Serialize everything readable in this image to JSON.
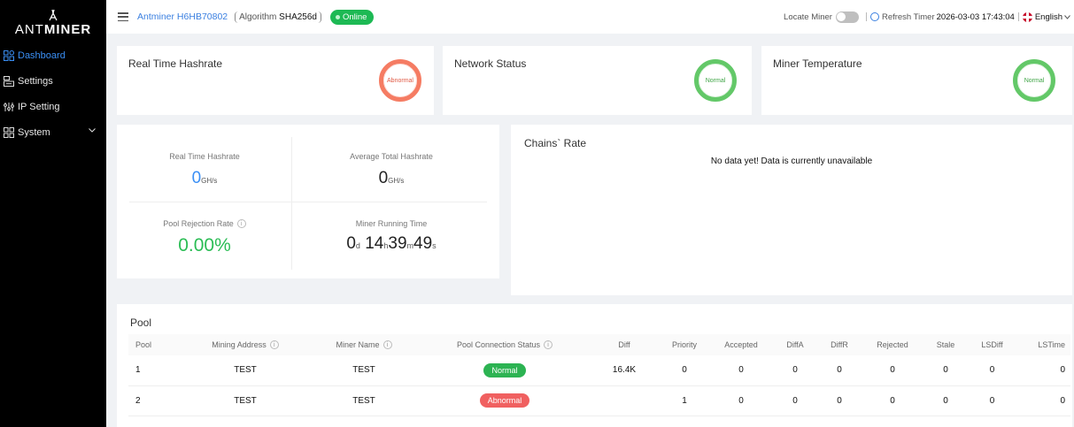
{
  "sidebar": {
    "logo_text_light": "ANT",
    "logo_text_bold": "MINER",
    "items": [
      {
        "label": "Dashboard"
      },
      {
        "label": "Settings"
      },
      {
        "label": "IP Setting"
      },
      {
        "label": "System"
      }
    ]
  },
  "header": {
    "miner_name": "Antminer H6HB70802",
    "algorithm_label": "Algorithm",
    "algorithm_value": "SHA256d",
    "status": "Online",
    "locate_label": "Locate Miner",
    "refresh_label": "Refresh Timer",
    "timestamp": "2026-03-03 17:43:04",
    "language": "English"
  },
  "status_cards": [
    {
      "title": "Real Time Hashrate",
      "state": "Abnormal"
    },
    {
      "title": "Network Status",
      "state": "Normal"
    },
    {
      "title": "Miner Temperature",
      "state": "Normal"
    }
  ],
  "metrics": {
    "rt_hashrate_label": "Real Time Hashrate",
    "rt_hashrate_value": "0",
    "rt_hashrate_unit": "GH/s",
    "avg_hashrate_label": "Average Total Hashrate",
    "avg_hashrate_value": "0",
    "avg_hashrate_unit": "GH/s",
    "rejection_label": "Pool Rejection Rate",
    "rejection_value": "0.00%",
    "runtime_label": "Miner Running Time",
    "runtime": {
      "d": "0",
      "d_u": "d",
      "h": "14",
      "h_u": "h",
      "m": "39",
      "m_u": "m",
      "s": "49",
      "s_u": "s"
    }
  },
  "chains": {
    "title": "Chains` Rate",
    "empty": "No data yet! Data is currently unavailable"
  },
  "pool": {
    "title": "Pool",
    "columns": [
      "Pool",
      "Mining Address",
      "Miner Name",
      "Pool Connection Status",
      "Diff",
      "Priority",
      "Accepted",
      "DiffA",
      "DiffR",
      "Rejected",
      "Stale",
      "LSDiff",
      "LSTime"
    ],
    "rows": [
      {
        "pool": "1",
        "address": "TEST",
        "miner": "TEST",
        "status": "Normal",
        "diff": "16.4K",
        "priority": "0",
        "accepted": "0",
        "diffa": "0",
        "diffr": "0",
        "rejected": "0",
        "stale": "0",
        "lsdiff": "0",
        "lstime": "0"
      },
      {
        "pool": "2",
        "address": "TEST",
        "miner": "TEST",
        "status": "Abnormal",
        "diff": "",
        "priority": "1",
        "accepted": "0",
        "diffa": "0",
        "diffr": "0",
        "rejected": "0",
        "stale": "0",
        "lsdiff": "0",
        "lstime": "0"
      }
    ]
  },
  "colors": {
    "accent": "#3a8ff5",
    "ok": "#2cb352",
    "bad": "#f06060",
    "sidebar_bg": "#000000"
  },
  "icons": [
    "dashboard-icon",
    "settings-icon",
    "ip-setting-icon",
    "system-icon",
    "menu-icon",
    "clock-icon",
    "flag-icon",
    "info-icon",
    "chevron-down-icon"
  ]
}
